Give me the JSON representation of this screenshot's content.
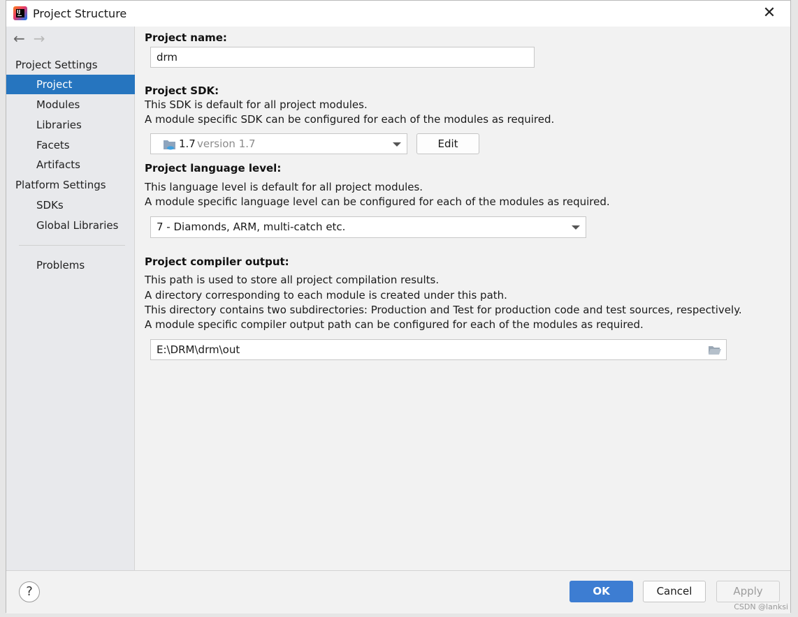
{
  "window": {
    "title": "Project Structure",
    "close_glyph": "✕",
    "icon": "intellij-idea-icon"
  },
  "sidebar": {
    "back_glyph": "←",
    "forward_glyph": "→",
    "project_settings_header": "Project Settings",
    "project_items": [
      {
        "label": "Project",
        "selected": true
      },
      {
        "label": "Modules"
      },
      {
        "label": "Libraries"
      },
      {
        "label": "Facets"
      },
      {
        "label": "Artifacts"
      }
    ],
    "platform_settings_header": "Platform Settings",
    "platform_items": [
      {
        "label": "SDKs"
      },
      {
        "label": "Global Libraries"
      }
    ],
    "problems_label": "Problems"
  },
  "main": {
    "project_name_label": "Project name:",
    "project_name_value": "drm",
    "sdk_label": "Project SDK:",
    "sdk_desc1": "This SDK is default for all project modules.",
    "sdk_desc2": "A module specific SDK can be configured for each of the modules as required.",
    "sdk_value": "1.7",
    "sdk_version": "version 1.7",
    "sdk_edit_label": "Edit",
    "lang_label": "Project language level:",
    "lang_desc1": "This language level is default for all project modules.",
    "lang_desc2": "A module specific language level can be configured for each of the modules as required.",
    "lang_value": "7 - Diamonds, ARM, multi-catch etc.",
    "output_label": "Project compiler output:",
    "output_desc1": "This path is used to store all project compilation results.",
    "output_desc2": "A directory corresponding to each module is created under this path.",
    "output_desc3": "This directory contains two subdirectories: Production and Test for production code and test sources, respectively.",
    "output_desc4": "A module specific compiler output path can be configured for each of the modules as required.",
    "output_value": "E:\\DRM\\drm\\out"
  },
  "footer": {
    "help_glyph": "?",
    "ok_label": "OK",
    "cancel_label": "Cancel",
    "apply_label": "Apply"
  },
  "watermark": "CSDN @lanksi",
  "colors": {
    "selection": "#2675bf",
    "ok_button": "#3d7dd2",
    "background": "#f2f2f2"
  }
}
